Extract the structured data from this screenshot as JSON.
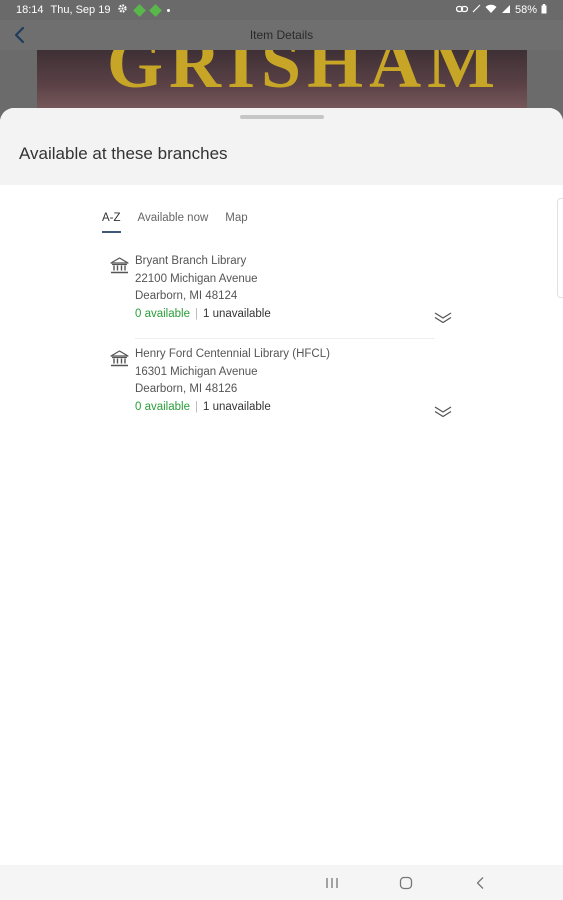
{
  "status_bar": {
    "time": "18:14",
    "date": "Thu, Sep 19",
    "battery": "58%"
  },
  "header": {
    "title": "Item Details"
  },
  "cover": {
    "text": "GRISHAM"
  },
  "sheet": {
    "title": "Available at these branches",
    "tabs": [
      {
        "label": "A-Z",
        "active": true
      },
      {
        "label": "Available now",
        "active": false
      },
      {
        "label": "Map",
        "active": false
      }
    ],
    "branches": [
      {
        "name": "Bryant Branch Library",
        "address": "22100 Michigan Avenue",
        "city": "Dearborn, MI 48124",
        "available": "0 available",
        "unavailable": "1 unavailable"
      },
      {
        "name": "Henry Ford Centennial Library (HFCL)",
        "address": "16301 Michigan Avenue",
        "city": "Dearborn, MI 48126",
        "available": "0 available",
        "unavailable": "1 unavailable"
      }
    ],
    "separator": "|"
  },
  "colors": {
    "available": "#2a9d3a",
    "tab_underline": "#3e5a7a",
    "cover_title": "#c7a527"
  }
}
